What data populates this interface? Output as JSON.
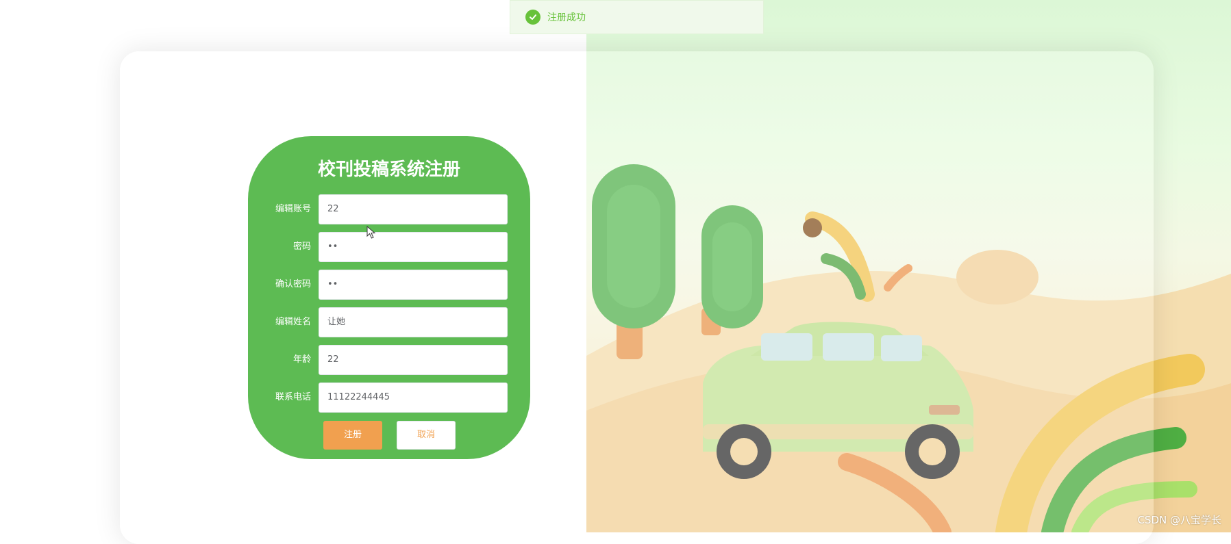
{
  "toast": {
    "message": "注册成功",
    "icon": "check-circle-icon",
    "color": "#67c23a"
  },
  "form": {
    "title": "校刊投稿系统注册",
    "fields": [
      {
        "label": "编辑账号",
        "value": "22"
      },
      {
        "label": "密码",
        "value": "••"
      },
      {
        "label": "确认密码",
        "value": "••"
      },
      {
        "label": "编辑姓名",
        "value": "让她"
      },
      {
        "label": "年龄",
        "value": "22"
      },
      {
        "label": "联系电话",
        "value": "11122244445"
      }
    ],
    "register_label": "注册",
    "cancel_label": "取消"
  },
  "colors": {
    "card": "#5dbb53",
    "accent": "#f1a04f"
  },
  "watermark": "CSDN @八宝学长"
}
